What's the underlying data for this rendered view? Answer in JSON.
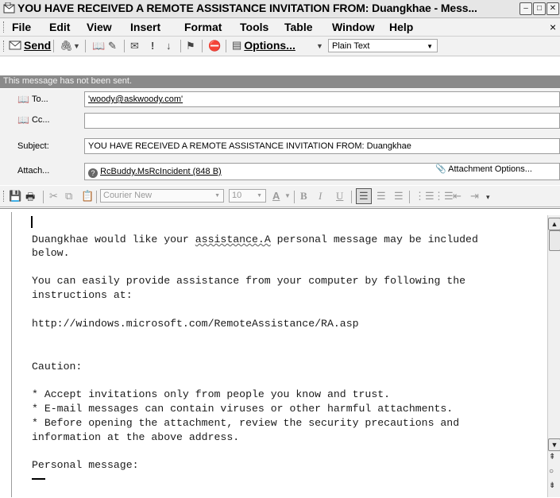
{
  "window": {
    "title": "YOU HAVE RECEIVED A REMOTE ASSISTANCE INVITATION FROM: Duangkhae - Mess...",
    "icons": [
      "message-icon",
      "minimize-icon",
      "maximize-icon",
      "close-icon"
    ]
  },
  "menu": {
    "items": [
      "File",
      "Edit",
      "View",
      "Insert",
      "Format",
      "Tools",
      "Table",
      "Window",
      "Help"
    ],
    "close_glyph": "×"
  },
  "toolbar": {
    "send_label": "Send",
    "options_label": "Options...",
    "format_value": "Plain Text",
    "icons": [
      "attach-icon",
      "address-book-icon",
      "check-names-icon",
      "envelope-icon",
      "importance-high-icon",
      "importance-low-icon",
      "flag-icon",
      "permission-icon",
      "message-options-icon"
    ]
  },
  "infobar": {
    "text": "This message has not been sent."
  },
  "header": {
    "to_label": "To...",
    "to_value": "'woody@askwoody.com'",
    "cc_label": "Cc...",
    "cc_value": "",
    "subject_label": "Subject:",
    "subject_value": "YOU HAVE RECEIVED A REMOTE ASSISTANCE INVITATION FROM: Duangkhae",
    "attach_label": "Attach...",
    "attachment_name": "RcBuddy.MsRcIncident (848 B)",
    "attachment_options_label": "Attachment Options..."
  },
  "formatting": {
    "font_name": "Courier New",
    "font_size": "10",
    "font_color_glyph": "A",
    "bold": "B",
    "italic": "I",
    "underline": "U"
  },
  "body": {
    "line1_pre": "Duangkhae would like your ",
    "line1_misspelled": "assistance.A",
    "line1_post": " personal message may be included",
    "line2": "below.",
    "line3": "You can easily provide assistance from your computer by following the",
    "line4": "instructions at:",
    "line5": "http://windows.microsoft.com/RemoteAssistance/RA.asp",
    "line6": "Caution:",
    "line7": "* Accept invitations only from people you know and trust.",
    "line8": "* E-mail messages can contain viruses or other harmful attachments.",
    "line9": "* Before opening the attachment, review the security precautions and",
    "line10": "information at the above address.",
    "line11": "Personal message:"
  },
  "colors": {
    "infobar": "#8a8a8a",
    "chrome": "#f2f2f2",
    "highlight": "#1f4e9c"
  }
}
